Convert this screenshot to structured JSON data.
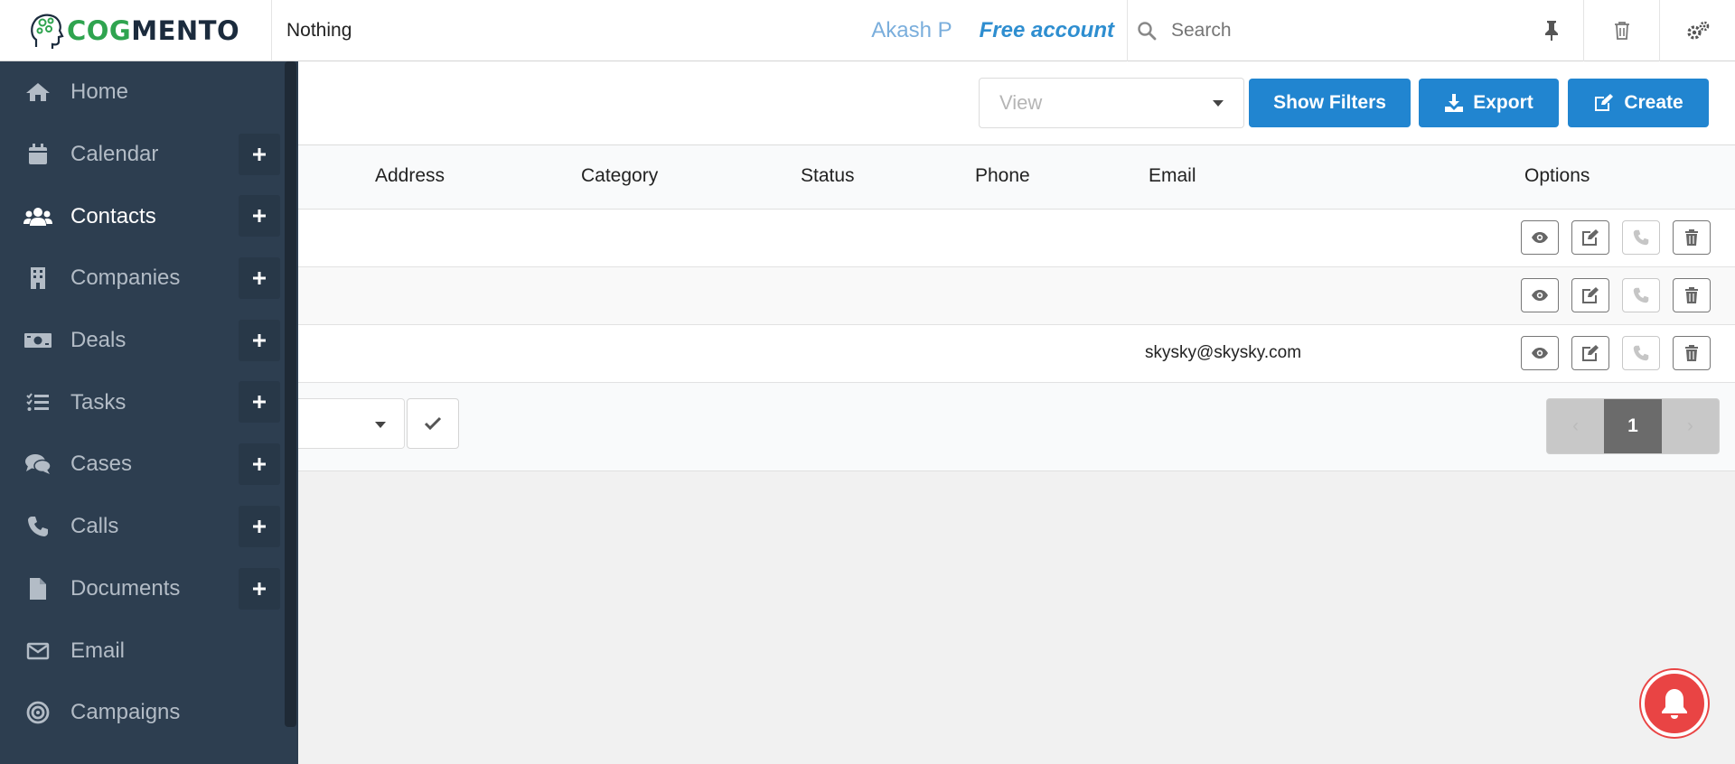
{
  "header": {
    "brand_cog": "COG",
    "brand_mento": "MENTO",
    "page_name": "Nothing",
    "user_name": "Akash P",
    "account_type": "Free account",
    "search_placeholder": "Search",
    "icons": [
      "pin-icon",
      "trash-icon",
      "settings-icon"
    ]
  },
  "sidebar": {
    "items": [
      {
        "label": "Home",
        "icon": "home-icon",
        "has_add": false,
        "active": false
      },
      {
        "label": "Calendar",
        "icon": "calendar-icon",
        "has_add": true,
        "active": false
      },
      {
        "label": "Contacts",
        "icon": "users-icon",
        "has_add": true,
        "active": true
      },
      {
        "label": "Companies",
        "icon": "building-icon",
        "has_add": true,
        "active": false
      },
      {
        "label": "Deals",
        "icon": "money-icon",
        "has_add": true,
        "active": false
      },
      {
        "label": "Tasks",
        "icon": "tasks-icon",
        "has_add": true,
        "active": false
      },
      {
        "label": "Cases",
        "icon": "comments-icon",
        "has_add": true,
        "active": false
      },
      {
        "label": "Calls",
        "icon": "phone-icon",
        "has_add": true,
        "active": false
      },
      {
        "label": "Documents",
        "icon": "file-icon",
        "has_add": true,
        "active": false
      },
      {
        "label": "Email",
        "icon": "envelope-icon",
        "has_add": false,
        "active": false
      },
      {
        "label": "Campaigns",
        "icon": "bullseye-icon",
        "has_add": false,
        "active": false
      }
    ]
  },
  "toolbar": {
    "view_placeholder": "View",
    "show_filters_label": "Show Filters",
    "export_label": "Export",
    "create_label": "Create"
  },
  "table": {
    "columns": [
      "Address",
      "Category",
      "Status",
      "Phone",
      "Email",
      "Options"
    ],
    "rows": [
      {
        "email": ""
      },
      {
        "email": ""
      },
      {
        "email": "skysky@skysky.com"
      }
    ]
  },
  "pagination": {
    "current_page": "1",
    "prev_label": "‹",
    "next_label": "›"
  },
  "colors": {
    "primary": "#2185d0",
    "sidebar_bg": "#2d3e50",
    "brand_green": "#2fa44f",
    "notification": "#e94444"
  }
}
